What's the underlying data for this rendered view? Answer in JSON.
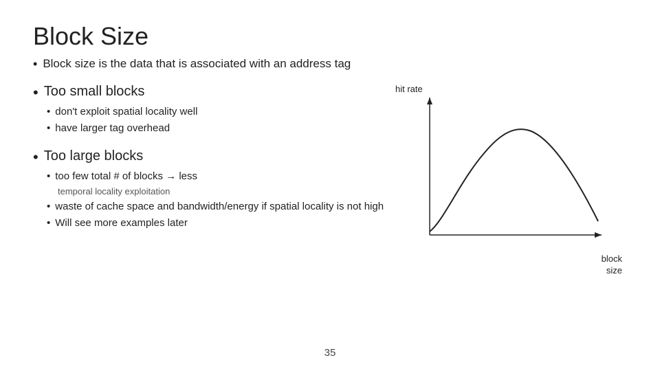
{
  "slide": {
    "title": "Block Size",
    "intro_bullet": "Block size is the data that is associated with an address tag",
    "section_small": {
      "heading": "Too small blocks",
      "bullets": [
        "don't exploit spatial locality well",
        "have larger tag overhead"
      ]
    },
    "section_large": {
      "heading": "Too large blocks",
      "bullets": [
        "too few total # of blocks → less",
        "temporal locality exploitation",
        "waste of cache space and bandwidth/energy if spatial locality is not high",
        "Will see more examples later"
      ]
    },
    "chart": {
      "y_label": "hit rate",
      "x_label": "block\nsize"
    },
    "page_number": "35"
  }
}
